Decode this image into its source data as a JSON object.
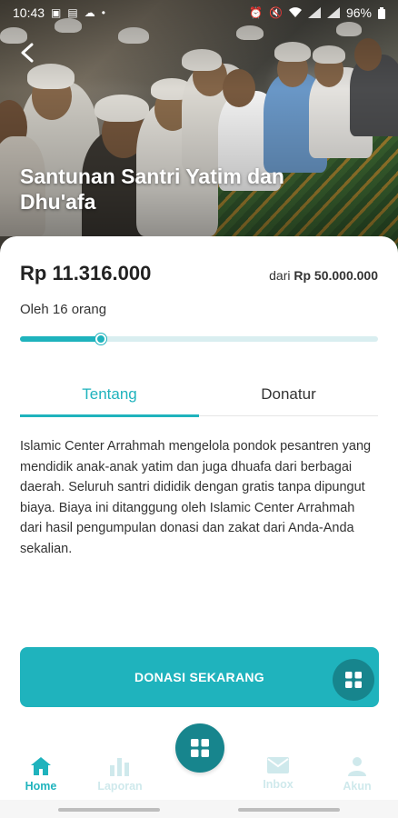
{
  "status_bar": {
    "time": "10:43",
    "battery": "96%",
    "left_icons": [
      "image-icon",
      "sim-icon",
      "cloud-icon",
      "dot-icon"
    ],
    "right_icons": [
      "alarm-icon",
      "mute-icon",
      "wifi-icon",
      "signal-icon",
      "signal-icon",
      "battery-icon"
    ]
  },
  "hero": {
    "title": "Santunan Santri Yatim dan Dhu'afa",
    "back_icon": "chevron-left-icon"
  },
  "campaign": {
    "raised": "Rp 11.316.000",
    "target_prefix": "dari",
    "target_amount": "Rp 50.000.000",
    "donors": "Oleh 16 orang",
    "progress_fraction": 0.226
  },
  "tabs": [
    {
      "label": "Tentang",
      "active": true
    },
    {
      "label": "Donatur",
      "active": false
    }
  ],
  "description": "Islamic Center Arrahmah mengelola pondok pesantren yang mendidik anak-anak yatim dan juga dhuafa dari berbagai daerah. Seluruh santri dididik dengan gratis tanpa dipungut biaya. Biaya ini ditanggung oleh Islamic Center Arrahmah dari hasil pengumpulan donasi dan zakat dari Anda-Anda sekalian.",
  "donate_button": {
    "label": "DONASI SEKARANG"
  },
  "bottom_nav": {
    "items": [
      {
        "label": "Home",
        "icon": "home-icon",
        "active": true
      },
      {
        "label": "Laporan",
        "icon": "bar-chart-icon",
        "active": false
      },
      {
        "label": "Inbox",
        "icon": "mail-icon",
        "active": false
      },
      {
        "label": "Akun",
        "icon": "user-icon",
        "active": false
      }
    ],
    "center_icon": "grid-icon"
  },
  "colors": {
    "accent": "#1fb3bd",
    "accent_dark": "#17858d",
    "nav_inactive": "#cfe9ec"
  }
}
